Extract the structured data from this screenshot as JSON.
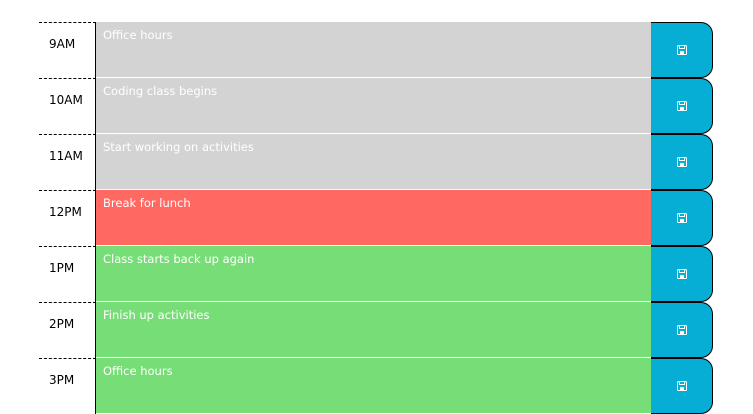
{
  "schedule": [
    {
      "hour": "9AM",
      "text": "Office hours",
      "state": "past",
      "save_icon": "save-icon"
    },
    {
      "hour": "10AM",
      "text": "Coding class begins",
      "state": "past",
      "save_icon": "save-icon"
    },
    {
      "hour": "11AM",
      "text": "Start working on activities",
      "state": "past",
      "save_icon": "save-icon"
    },
    {
      "hour": "12PM",
      "text": "Break for lunch",
      "state": "present",
      "save_icon": "save-icon"
    },
    {
      "hour": "1PM",
      "text": "Class starts back up again",
      "state": "future",
      "save_icon": "save-icon"
    },
    {
      "hour": "2PM",
      "text": "Finish up activities",
      "state": "future",
      "save_icon": "save-icon"
    },
    {
      "hour": "3PM",
      "text": "Office hours",
      "state": "future",
      "save_icon": "save-icon"
    }
  ],
  "colors": {
    "past": "#d3d3d3",
    "present": "#ff6961",
    "future": "#77dd77",
    "save_button": "#06aed5"
  }
}
